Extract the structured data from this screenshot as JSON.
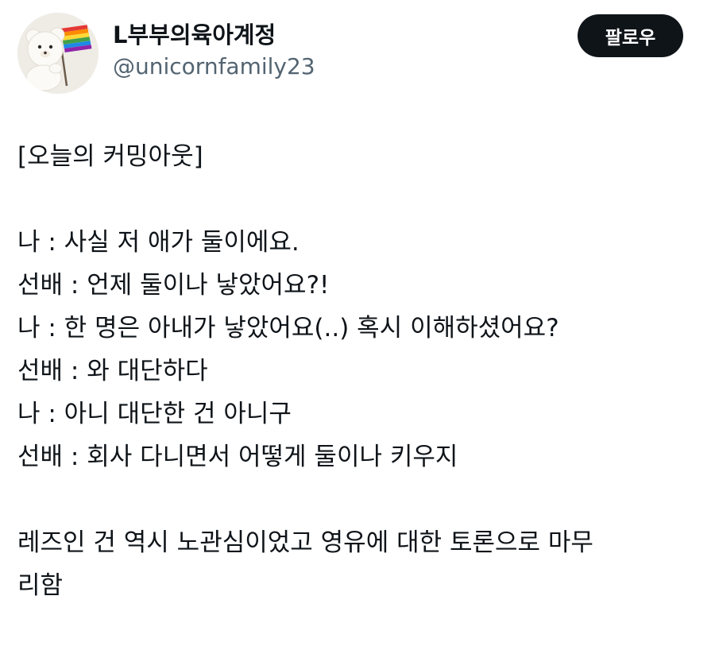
{
  "author": {
    "display_name": "L부부의육아계정",
    "handle": "@unicornfamily23",
    "avatar": "teddy-bear-with-rainbow-flag-avatar"
  },
  "follow_button": {
    "label": "팔로우"
  },
  "tweet": {
    "lines": [
      "[오늘의 커밍아웃]",
      "",
      "나 : 사실 저 애가 둘이에요.",
      "선배 : 언제 둘이나 낳았어요?!",
      "나 : 한 명은 아내가 낳았어요(..) 혹시 이해하셨어요?",
      "선배 : 와 대단하다",
      "나 : 아니 대단한 건 아니구",
      "선배 : 회사 다니면서 어떻게 둘이나 키우지",
      "",
      "레즈인 건 역시 노관심이었고 영유에 대한 토론으로 마무",
      "리함"
    ]
  },
  "colors": {
    "text": "#0f1419",
    "secondary_text": "#536471",
    "button_bg": "#0f1419",
    "button_text": "#ffffff",
    "background": "#ffffff"
  }
}
